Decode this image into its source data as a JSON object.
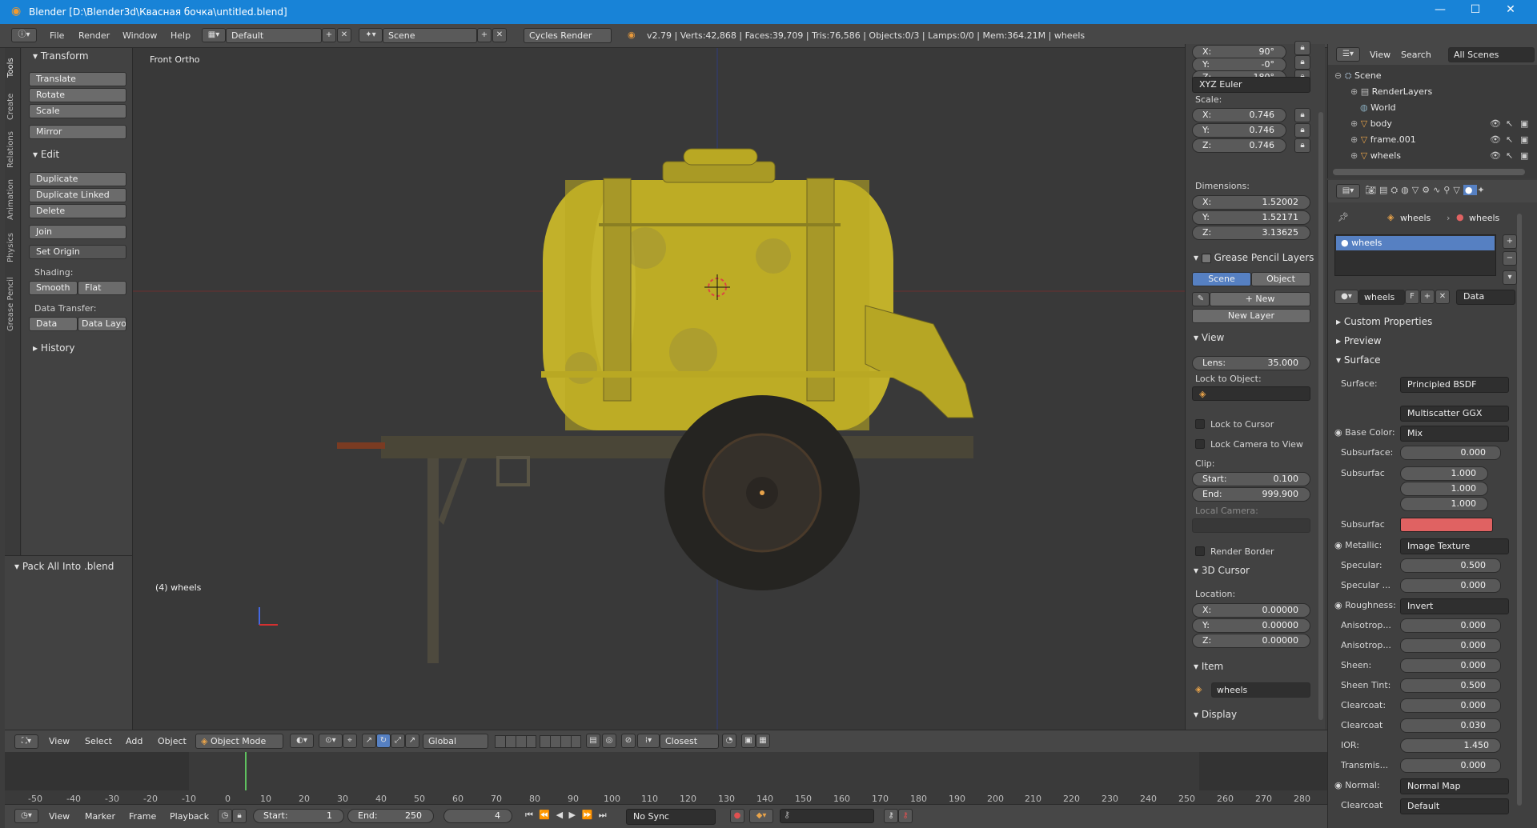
{
  "titlebar": {
    "title": "Blender [D:\\Blender3d\\Квасная бочка\\untitled.blend]"
  },
  "topbar": {
    "menus": [
      "File",
      "Render",
      "Window",
      "Help"
    ],
    "layout": "Default",
    "scene": "Scene",
    "engine": "Cycles Render",
    "stats": "v2.79 | Verts:42,868 | Faces:39,709 | Tris:76,586 | Objects:0/3 | Lamps:0/0 | Mem:364.21M | wheels"
  },
  "tabs": [
    "Tools",
    "Create",
    "Relations",
    "Animation",
    "Physics",
    "Grease Pencil"
  ],
  "toolshelf": {
    "transform_header": "Transform",
    "translate": "Translate",
    "rotate": "Rotate",
    "scale": "Scale",
    "mirror": "Mirror",
    "edit_header": "Edit",
    "duplicate": "Duplicate",
    "duplicate_linked": "Duplicate Linked",
    "delete": "Delete",
    "join": "Join",
    "set_origin": "Set Origin",
    "shading_label": "Shading:",
    "smooth": "Smooth",
    "flat": "Flat",
    "data_transfer_label": "Data Transfer:",
    "data": "Data",
    "data_layo": "Data Layo",
    "history_header": "History",
    "pack_header": "Pack All Into .blend"
  },
  "viewport": {
    "view_name": "Front Ortho",
    "object_label": "(4) wheels"
  },
  "npanel": {
    "rot_x": "90°",
    "rot_y": "-0°",
    "rot_z": "180°",
    "rotation_mode": "XYZ Euler",
    "scale_label": "Scale:",
    "scale_x": "0.746",
    "scale_y": "0.746",
    "scale_z": "0.746",
    "dimensions_label": "Dimensions:",
    "dim_x": "1.52002",
    "dim_y": "1.52171",
    "dim_z": "3.13625",
    "gp_header": "Grease Pencil Layers",
    "gp_scene": "Scene",
    "gp_object": "Object",
    "gp_new": "New",
    "gp_new_layer": "New Layer",
    "view_header": "View",
    "lens_label": "Lens:",
    "lens": "35.000",
    "lock_to_object": "Lock to Object:",
    "lock_to_cursor": "Lock to Cursor",
    "lock_camera": "Lock Camera to View",
    "clip_label": "Clip:",
    "clip_start_label": "Start:",
    "clip_start": "0.100",
    "clip_end_label": "End:",
    "clip_end": "999.900",
    "local_camera": "Local Camera:",
    "render_border": "Render Border",
    "cursor_header": "3D Cursor",
    "location_label": "Location:",
    "cur_x": "0.00000",
    "cur_y": "0.00000",
    "cur_z": "0.00000",
    "item_header": "Item",
    "item_name": "wheels",
    "display_header": "Display",
    "x": "X:",
    "y": "Y:",
    "z": "Z:"
  },
  "outliner": {
    "view": "View",
    "search": "Search",
    "filter": "All Scenes",
    "items": [
      "Scene",
      "RenderLayers",
      "World",
      "body",
      "frame.001",
      "wheels"
    ]
  },
  "props": {
    "breadcrumb_obj": "wheels",
    "breadcrumb_mat": "wheels",
    "slot": "wheels",
    "mat_name": "wheels",
    "mat_users": "F",
    "data_mode": "Data",
    "custom_properties": "Custom Properties",
    "preview": "Preview",
    "surface_header": "Surface",
    "surface_label": "Surface:",
    "surface_value": "Principled BSDF",
    "distribution": "Multiscatter GGX",
    "base_color_label": "Base Color:",
    "base_color_value": "Mix",
    "subsurface_label": "Subsurface:",
    "subsurface_value": "0.000",
    "subsurf_radius_label": "Subsurfac",
    "sr1": "1.000",
    "sr2": "1.000",
    "sr3": "1.000",
    "subsurf_color_label": "Subsurfac",
    "metallic_label": "Metallic:",
    "metallic_value": "Image Texture",
    "specular_label": "Specular:",
    "specular_value": "0.500",
    "spec_tint_label": "Specular ...",
    "spec_tint_value": "0.000",
    "roughness_label": "Roughness:",
    "roughness_value": "Invert",
    "aniso_label": "Anisotrop...",
    "aniso_value": "0.000",
    "aniso_rot_label": "Anisotrop...",
    "aniso_rot_value": "0.000",
    "sheen_label": "Sheen:",
    "sheen_value": "0.000",
    "sheen_tint_label": "Sheen Tint:",
    "sheen_tint_value": "0.500",
    "clearcoat_label": "Clearcoat:",
    "clearcoat_value": "0.000",
    "clearcoat2_label": "Clearcoat",
    "clearcoat2_value": "0.030",
    "ior_label": "IOR:",
    "ior_value": "1.450",
    "transmis_label": "Transmis...",
    "transmis_value": "0.000",
    "normal_label": "Normal:",
    "normal_value": "Normal Map",
    "clearcoat3_label": "Clearcoat",
    "clearcoat3_value": "Default",
    "colors": {
      "subsurface_color": "#e06262",
      "selected": "#5680c2"
    }
  },
  "viewheader": {
    "view": "View",
    "select": "Select",
    "add": "Add",
    "object": "Object",
    "mode": "Object Mode",
    "orientation": "Global",
    "snap": "Closest"
  },
  "timeline": {
    "ticks": [
      "-50",
      "-40",
      "-30",
      "-20",
      "-10",
      "0",
      "10",
      "20",
      "30",
      "40",
      "50",
      "60",
      "70",
      "80",
      "90",
      "100",
      "110",
      "120",
      "130",
      "140",
      "150",
      "160",
      "170",
      "180",
      "190",
      "200",
      "210",
      "220",
      "230",
      "240",
      "250",
      "260",
      "270",
      "280"
    ]
  },
  "timeheader": {
    "view": "View",
    "marker": "Marker",
    "frame": "Frame",
    "playback": "Playback",
    "start_label": "Start:",
    "start": "1",
    "end_label": "End:",
    "end": "250",
    "current": "4",
    "sync": "No Sync"
  }
}
